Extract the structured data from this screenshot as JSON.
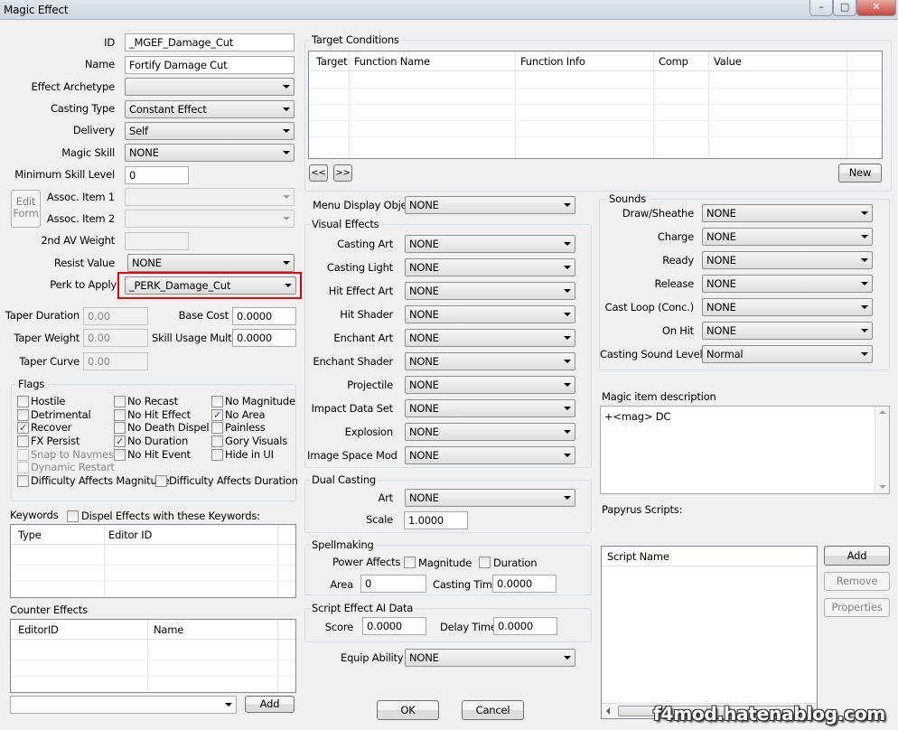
{
  "window": {
    "title": "Magic Effect"
  },
  "main": {
    "id_label": "ID",
    "id_value": "_MGEF_Damage_Cut",
    "name_label": "Name",
    "name_value": "Fortify Damage Cut",
    "archetype_label": "Effect Archetype",
    "archetype_value": "",
    "casting_type_label": "Casting Type",
    "casting_type_value": "Constant Effect",
    "delivery_label": "Delivery",
    "delivery_value": "Self",
    "magic_skill_label": "Magic Skill",
    "magic_skill_value": "NONE",
    "min_skill_label": "Minimum Skill Level",
    "min_skill_value": "0",
    "edit_form_label": "Edit Form",
    "assoc1_label": "Assoc. Item 1",
    "assoc2_label": "Assoc. Item 2",
    "av_weight_label": "2nd AV Weight",
    "resist_label": "Resist Value",
    "resist_value": "NONE",
    "perk_label": "Perk to Apply",
    "perk_value": "_PERK_Damage_Cut",
    "taper_duration_label": "Taper Duration",
    "taper_duration_value": "0.00",
    "taper_weight_label": "Taper Weight",
    "taper_weight_value": "0.00",
    "taper_curve_label": "Taper Curve",
    "taper_curve_value": "0.00",
    "base_cost_label": "Base Cost",
    "base_cost_value": "0.0000",
    "skill_usage_label": "Skill Usage Mult",
    "skill_usage_value": "0.0000"
  },
  "flags": {
    "title": "Flags",
    "items": [
      {
        "label": "Hostile",
        "checked": false,
        "enabled": true
      },
      {
        "label": "No Recast",
        "checked": false,
        "enabled": true
      },
      {
        "label": "No Magnitude",
        "checked": false,
        "enabled": true
      },
      {
        "label": "Detrimental",
        "checked": false,
        "enabled": true
      },
      {
        "label": "No Hit Effect",
        "checked": false,
        "enabled": true
      },
      {
        "label": "No Area",
        "checked": true,
        "enabled": true
      },
      {
        "label": "Recover",
        "checked": true,
        "enabled": true
      },
      {
        "label": "No Death Dispel",
        "checked": false,
        "enabled": true
      },
      {
        "label": "Painless",
        "checked": false,
        "enabled": true
      },
      {
        "label": "FX Persist",
        "checked": false,
        "enabled": true
      },
      {
        "label": "No Duration",
        "checked": true,
        "enabled": true
      },
      {
        "label": "Gory Visuals",
        "checked": false,
        "enabled": true
      },
      {
        "label": "Snap to Navmesh",
        "checked": false,
        "enabled": false
      },
      {
        "label": "No Hit Event",
        "checked": false,
        "enabled": true
      },
      {
        "label": "Hide in UI",
        "checked": false,
        "enabled": true
      },
      {
        "label": "Dynamic Restart",
        "checked": false,
        "enabled": false
      },
      {
        "label": "Difficulty Affects Magnitude",
        "checked": false,
        "enabled": true
      },
      {
        "label": "Difficulty Affects Duration",
        "checked": false,
        "enabled": true
      }
    ]
  },
  "keywords": {
    "title": "Keywords",
    "dispel_label": "Dispel Effects with these Keywords:",
    "col_type": "Type",
    "col_editor_id": "Editor ID"
  },
  "counter_effects": {
    "title": "Counter Effects",
    "col_editor_id": "EditorID",
    "col_name": "Name",
    "add_label": "Add"
  },
  "target_conditions": {
    "title": "Target Conditions",
    "columns": [
      "Target",
      "Function Name",
      "Function Info",
      "Comp",
      "Value"
    ],
    "prev_label": "<<",
    "next_label": ">>",
    "new_label": "New"
  },
  "menu_display": {
    "label": "Menu Display Object",
    "value": "NONE"
  },
  "visual_effects": {
    "title": "Visual Effects",
    "rows": [
      {
        "label": "Casting Art",
        "value": "NONE"
      },
      {
        "label": "Casting Light",
        "value": "NONE"
      },
      {
        "label": "Hit Effect Art",
        "value": "NONE"
      },
      {
        "label": "Hit Shader",
        "value": "NONE"
      },
      {
        "label": "Enchant Art",
        "value": "NONE"
      },
      {
        "label": "Enchant Shader",
        "value": "NONE"
      },
      {
        "label": "Projectile",
        "value": "NONE"
      },
      {
        "label": "Impact Data Set",
        "value": "NONE"
      },
      {
        "label": "Explosion",
        "value": "NONE"
      },
      {
        "label": "Image Space Mod",
        "value": "NONE"
      }
    ]
  },
  "dual_casting": {
    "title": "Dual Casting",
    "art_label": "Art",
    "art_value": "NONE",
    "scale_label": "Scale",
    "scale_value": "1.0000"
  },
  "spellmaking": {
    "title": "Spellmaking",
    "power_affects_label": "Power Affects",
    "magnitude_label": "Magnitude",
    "duration_label": "Duration",
    "area_label": "Area",
    "area_value": "0",
    "casting_time_label": "Casting Time",
    "casting_time_value": "0.0000"
  },
  "script_ai": {
    "title": "Script Effect AI Data",
    "score_label": "Score",
    "score_value": "0.0000",
    "delay_label": "Delay Time",
    "delay_value": "0.0000"
  },
  "equip_ability": {
    "label": "Equip Ability",
    "value": "NONE"
  },
  "footer": {
    "ok_label": "OK",
    "cancel_label": "Cancel"
  },
  "sounds": {
    "title": "Sounds",
    "rows": [
      {
        "label": "Draw/Sheathe",
        "value": "NONE"
      },
      {
        "label": "Charge",
        "value": "NONE"
      },
      {
        "label": "Ready",
        "value": "NONE"
      },
      {
        "label": "Release",
        "value": "NONE"
      },
      {
        "label": "Cast Loop (Conc.)",
        "value": "NONE"
      },
      {
        "label": "On Hit",
        "value": "NONE"
      },
      {
        "label": "Casting Sound Level",
        "value": "Normal"
      }
    ]
  },
  "description": {
    "label": "Magic item description",
    "value": "+<mag> DC"
  },
  "papyrus": {
    "label": "Papyrus Scripts:",
    "col_script_name": "Script Name",
    "add_label": "Add",
    "remove_label": "Remove",
    "properties_label": "Properties"
  },
  "watermark": "f4mod.hatenablog.com",
  "colors": {
    "highlight_border": "#e00000",
    "window_bg": "#f0f0f0"
  },
  "icons": {
    "minimize": "minimize-icon",
    "maximize": "maximize-icon",
    "close": "close-icon"
  }
}
